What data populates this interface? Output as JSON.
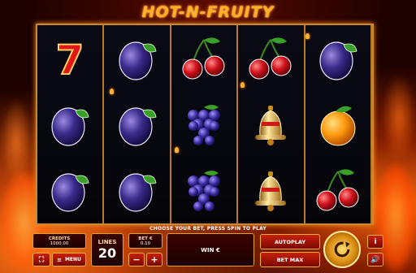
{
  "game": {
    "title": "HOT-N-FRUITY"
  },
  "reels": [
    {
      "symbols": [
        "seven",
        "plum",
        "plum"
      ]
    },
    {
      "symbols": [
        "plum",
        "plum",
        "plum"
      ]
    },
    {
      "symbols": [
        "cherries",
        "grapes",
        "grapes"
      ]
    },
    {
      "symbols": [
        "cherries",
        "bell",
        "bell"
      ]
    },
    {
      "symbols": [
        "plum",
        "orange",
        "cherries"
      ]
    }
  ],
  "hint": "CHOOSE YOUR BET, PRESS SPIN TO PLAY",
  "panel": {
    "credits_label": "CREDITS",
    "credits_value": "1000.00",
    "lines_label": "LINES",
    "lines_value": "20",
    "bet_label": "BET €",
    "bet_value": "0.10",
    "win_label": "WIN €",
    "autoplay_label": "AUTOPLAY",
    "betmax_label": "BET MAX",
    "menu_label": "MENU",
    "minus_label": "−",
    "plus_label": "+",
    "info_label": "i",
    "seven_glyph": "7"
  },
  "colors": {
    "accent": "#e0a030",
    "panel": "#3a0400",
    "button": "#c8200c"
  }
}
